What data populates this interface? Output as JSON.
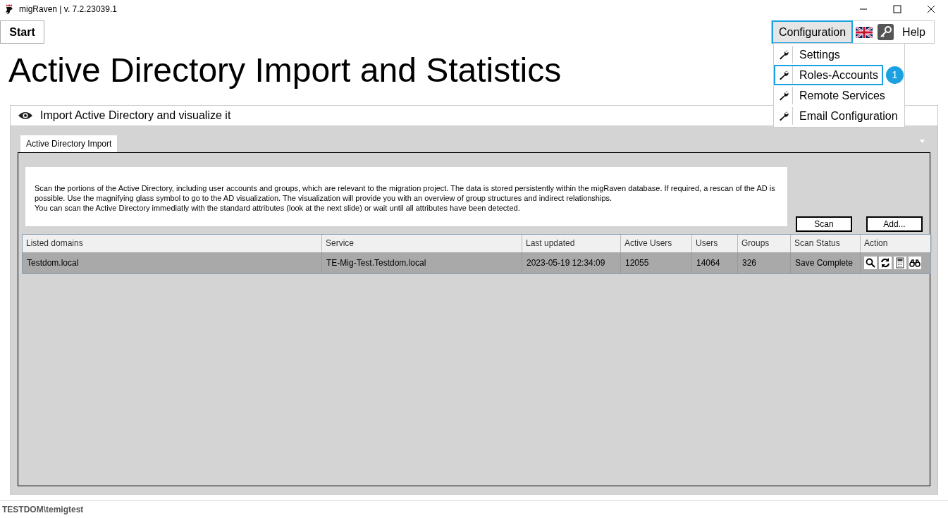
{
  "window": {
    "title": "migRaven | v. 7.2.23039.1"
  },
  "toolbar": {
    "start_button": "Start",
    "configuration_button": {
      "label": "Configuration",
      "highlighted": true
    },
    "help_button": "Help"
  },
  "configuration_menu": [
    {
      "label": "Settings",
      "highlighted": false
    },
    {
      "label": "Roles-Accounts",
      "highlighted": true,
      "callout": "1"
    },
    {
      "label": "Remote Services",
      "highlighted": false
    },
    {
      "label": "Email Configuration",
      "highlighted": false
    }
  ],
  "heading": "Active Directory Import and Statistics",
  "panel": {
    "title": "Import Active Directory and visualize it",
    "tabs": [
      {
        "label": "Active Directory Import",
        "selected": true
      }
    ],
    "description": [
      "Scan the portions of the Active Directory, including user accounts and groups, which are relevant to the migration project. The data is stored persistently within the migRaven database. If required, a rescan of the AD is possible. Use the magnifying glass symbol to go to the AD visualization. The visualization will provide you with an overview of group structures and indirect relationships.",
      "You can scan the Active Directory immediatly with the standard attributes (look at the next slide) or wait until all attributes have been detected."
    ],
    "buttons": [
      "Scan",
      "Add..."
    ],
    "table": {
      "columns": [
        "Listed domains",
        "Service",
        "Last updated",
        "Active Users",
        "Users",
        "Groups",
        "Scan Status",
        "Action"
      ],
      "rows": [
        {
          "cells": [
            "Testdom.local",
            "TE-Mig-Test.Testdom.local",
            "2023-05-19 12:34:09",
            "12055",
            "14064",
            "326",
            "Save Complete"
          ],
          "selected": true
        }
      ]
    }
  },
  "status_bar": "TESTDOM\\temigtest"
}
